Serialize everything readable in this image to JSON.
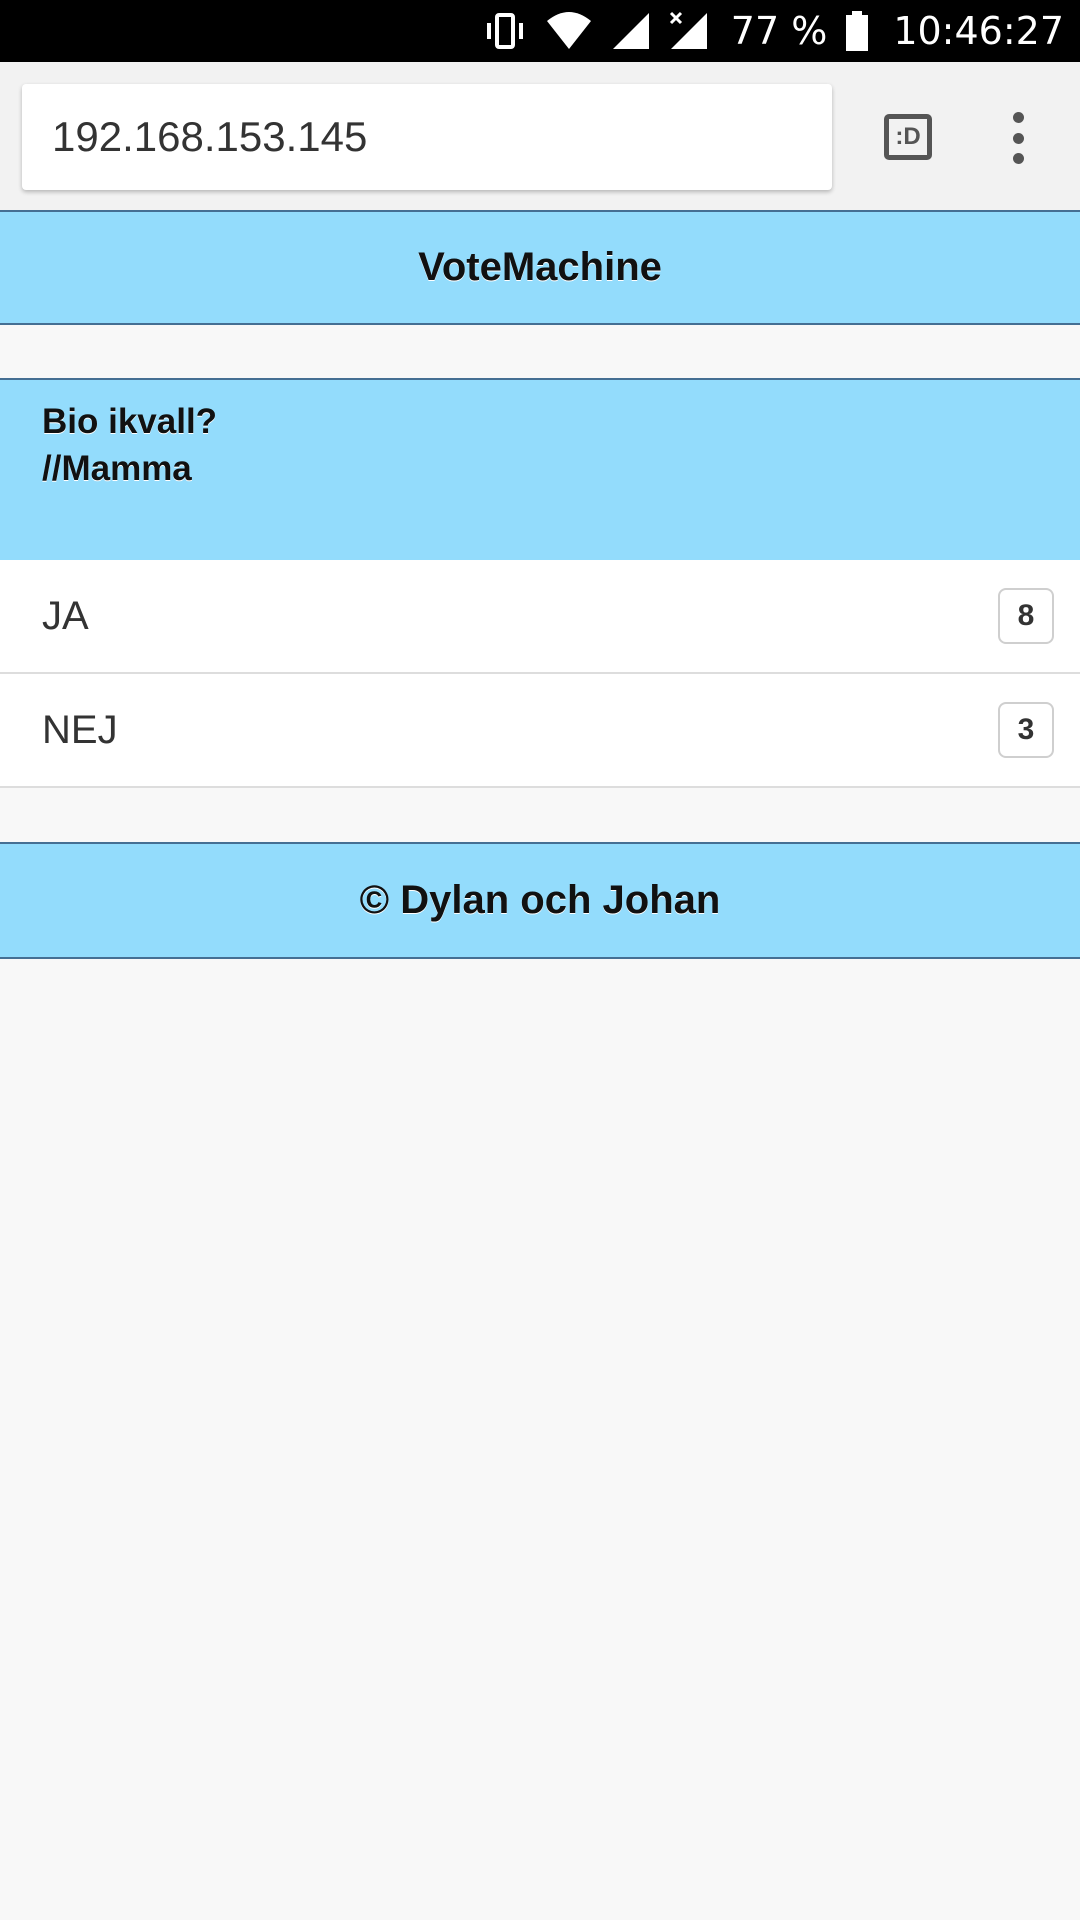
{
  "status_bar": {
    "icons": [
      "vibrate-icon",
      "wifi-icon",
      "signal-icon",
      "signal-no-data-icon",
      "battery-icon"
    ],
    "battery_percent": "77 %",
    "time": "10:46:27"
  },
  "browser": {
    "url": "192.168.153.145",
    "tab_switcher_label": ":D",
    "menu_icon": "more-vert-icon"
  },
  "app": {
    "title": "VoteMachine",
    "question_line1": "Bio ikvall?",
    "question_line2": "//Mamma",
    "options": [
      {
        "label": "JA",
        "count": "8"
      },
      {
        "label": "NEJ",
        "count": "3"
      }
    ],
    "footer": "© Dylan och Johan"
  },
  "colors": {
    "accent": "#93dcfc",
    "border": "#456f93",
    "background": "#f8f8f8"
  }
}
